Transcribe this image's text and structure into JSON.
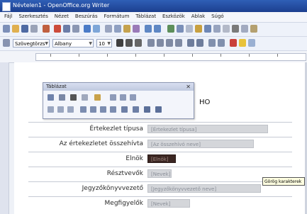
{
  "window": {
    "title": "Névtelen1 - OpenOffice.org Writer"
  },
  "menubar": {
    "items": [
      "Fájl",
      "Szerkesztés",
      "Nézet",
      "Beszúrás",
      "Formátum",
      "Táblázat",
      "Eszközök",
      "Ablak",
      "Súgó"
    ]
  },
  "formatting": {
    "style": "Szövegtörzs",
    "font": "Albany",
    "size": "10"
  },
  "document": {
    "partial_text": "HO",
    "table_rows": [
      {
        "label": "Értekezlet típusa",
        "field": "[Értekezlet típusa]"
      },
      {
        "label": "Az értekezletet összehívta",
        "field": "[Az összehívó neve]"
      },
      {
        "label": "Elnök",
        "field": "[Elnök]"
      },
      {
        "label": "Résztvevők",
        "field": "[Nevek]"
      },
      {
        "label": "Jegyzőkönyvvezető",
        "field": "[Jegyzőkönyvvezető neve]"
      },
      {
        "label": "Megfigyelők",
        "field": "[Nevek]"
      }
    ]
  },
  "floating_toolbar": {
    "title": "Táblázat"
  },
  "tooltip": {
    "text": "Görög karakterek"
  },
  "colors": {
    "titlebar": "#2f5fb6",
    "field_bg": "#d4d6da",
    "field_dark": "#3b2622"
  }
}
